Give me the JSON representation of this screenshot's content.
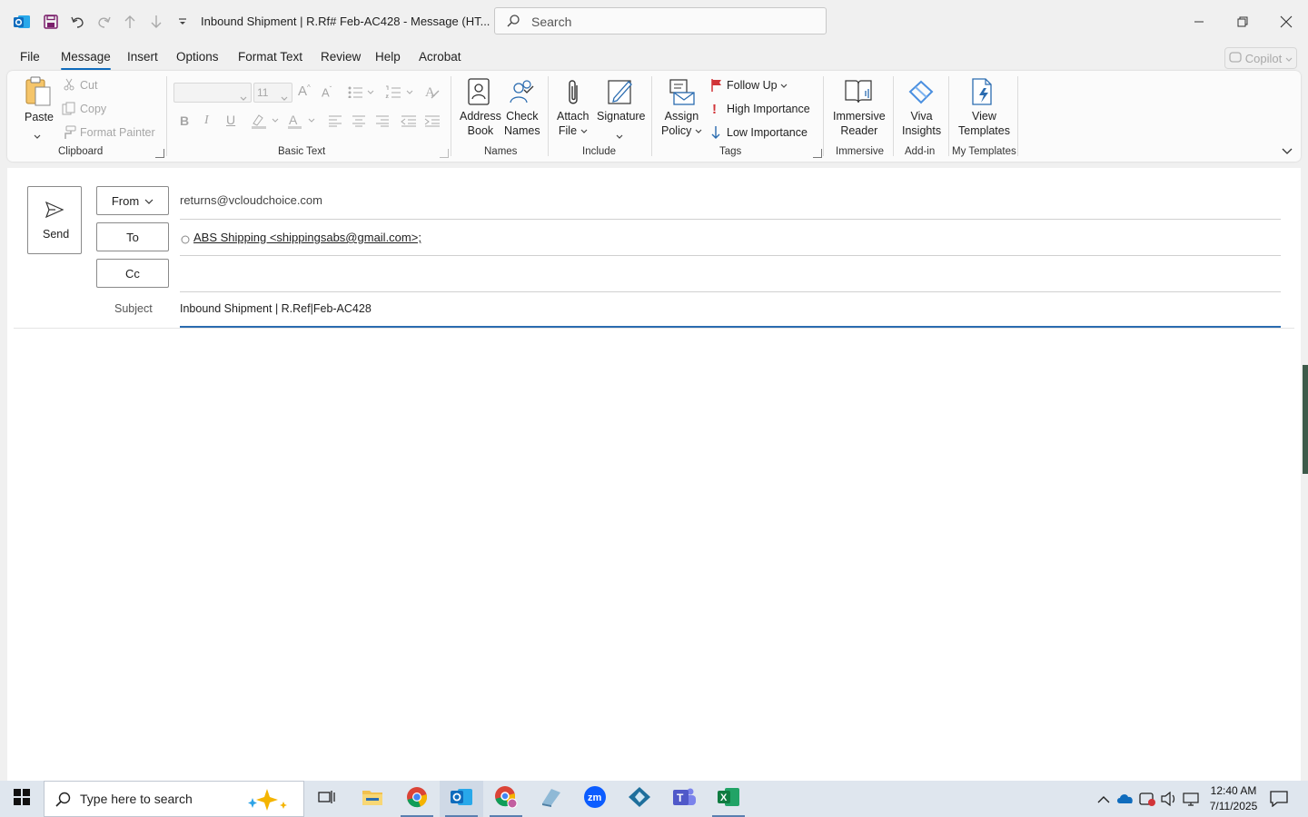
{
  "titlebar": {
    "title": "Inbound Shipment | R.Rf# Feb-AC428  -  Message (HT...",
    "search_placeholder": "Search"
  },
  "tabs": [
    "File",
    "Message",
    "Insert",
    "Options",
    "Format Text",
    "Review",
    "Help",
    "Acrobat"
  ],
  "active_tab": "Message",
  "copilot_label": "Copilot",
  "ribbon": {
    "clipboard": {
      "paste": "Paste",
      "cut": "Cut",
      "copy": "Copy",
      "format_painter": "Format Painter",
      "label": "Clipboard"
    },
    "basic_text": {
      "font_size": "11",
      "label": "Basic Text"
    },
    "names": {
      "address_book_1": "Address",
      "address_book_2": "Book",
      "check_names_1": "Check",
      "check_names_2": "Names",
      "label": "Names"
    },
    "include": {
      "attach_1": "Attach",
      "attach_2": "File",
      "signature": "Signature",
      "label": "Include"
    },
    "tags": {
      "assign_1": "Assign",
      "assign_2": "Policy",
      "follow_up": "Follow Up",
      "high": "High Importance",
      "low": "Low Importance",
      "label": "Tags"
    },
    "immersive": {
      "reader_1": "Immersive",
      "reader_2": "Reader",
      "label": "Immersive"
    },
    "addin": {
      "viva_1": "Viva",
      "viva_2": "Insights",
      "label": "Add-in"
    },
    "templates": {
      "view_1": "View",
      "view_2": "Templates",
      "label": "My Templates"
    }
  },
  "compose": {
    "send_label": "Send",
    "from_label": "From",
    "from_value": "returns@vcloudchoice.com",
    "to_label": "To",
    "to_value": "ABS Shipping <shippingsabs@gmail.com>;",
    "cc_label": "Cc",
    "subject_label": "Subject",
    "subject_value": "Inbound Shipment | R.Ref|Feb-AC428"
  },
  "taskbar": {
    "search_placeholder": "Type here to search",
    "time": "12:40 AM",
    "date": "7/11/2025"
  },
  "colors": {
    "accent": "#0f6cbd",
    "outlook": "#0f6cbd",
    "flag": "#d13438"
  }
}
